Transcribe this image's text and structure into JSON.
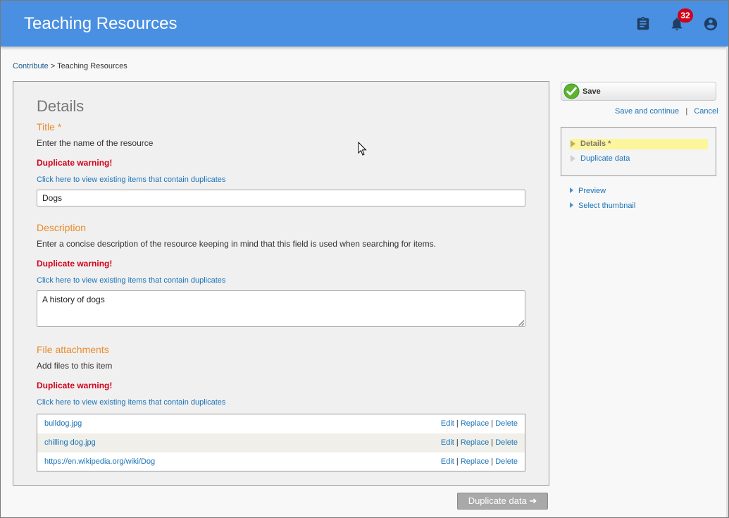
{
  "header": {
    "title": "Teaching Resources",
    "icons": [
      "clipboard-icon",
      "bell-icon",
      "account-icon"
    ],
    "notification_count": "32",
    "accent_color": "#4a90e2"
  },
  "breadcrumb": {
    "root": "Contribute",
    "separator": " > ",
    "current": "Teaching Resources"
  },
  "details": {
    "heading": "Details",
    "title_section": {
      "label": "Title *",
      "help": "Enter the name of the resource",
      "warning": "Duplicate warning!",
      "link": "Click here to view existing items that contain duplicates",
      "value": "Dogs"
    },
    "description_section": {
      "label": "Description",
      "help": "Enter a concise description of the resource keeping in mind that this field is used when searching for items.",
      "warning": "Duplicate warning!",
      "link": "Click here to view existing items that contain duplicates",
      "value": "A history of dogs"
    },
    "attachments_section": {
      "label": "File attachments",
      "help": "Add files to this item",
      "warning": "Duplicate warning!",
      "link": "Click here to view existing items that contain duplicates",
      "rows": [
        {
          "name": "bulldog.jpg",
          "edit": "Edit",
          "replace": "Replace",
          "delete": "Delete"
        },
        {
          "name": "chilling dog.jpg",
          "edit": "Edit",
          "replace": "Replace",
          "delete": "Delete"
        },
        {
          "name": "https://en.wikipedia.org/wiki/Dog",
          "edit": "Edit",
          "replace": "Replace",
          "delete": "Delete"
        }
      ]
    },
    "next_button": "Duplicate data ➔"
  },
  "sidebar": {
    "save_label": "Save",
    "save_continue": "Save and continue",
    "link_sep": "|",
    "cancel": "Cancel",
    "steps": [
      {
        "label": "Details *",
        "active": true
      },
      {
        "label": "Duplicate data",
        "active": false
      }
    ],
    "links": [
      "Preview",
      "Select thumbnail"
    ]
  },
  "colors": {
    "warning": "#d0021b",
    "section_title": "#e98b2a",
    "link": "#1a73b8"
  }
}
